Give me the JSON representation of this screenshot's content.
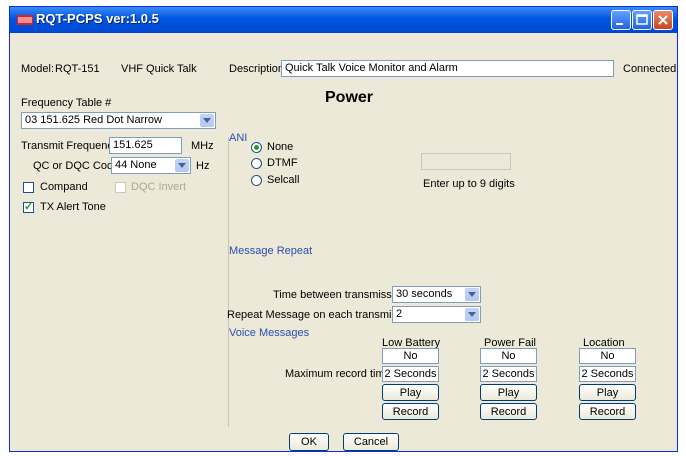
{
  "window": {
    "title": "RQT-PCPS ver:1.0.5"
  },
  "header": {
    "model_label": "Model:",
    "model_value": "RQT-151",
    "model_type": "VHF Quick Talk",
    "description_label": "Description:",
    "description_value": "Quick Talk Voice Monitor and Alarm",
    "status": "Connected"
  },
  "page_title": "Power",
  "left": {
    "freq_table_label": "Frequency Table #",
    "freq_table_value": "03  151.625  Red Dot  Narrow",
    "tx_freq_label": "Transmit Frequency",
    "tx_freq_value": "151.625",
    "tx_freq_unit": "MHz",
    "qc_label": "QC or DQC Code:",
    "qc_value": "44 None",
    "qc_unit": "Hz",
    "compand_label": "Compand",
    "compand_checked": false,
    "dqc_invert_label": "DQC Invert",
    "tx_alert_label": "TX Alert Tone",
    "tx_alert_checked": true
  },
  "ani": {
    "group_label": "ANI",
    "options": [
      "None",
      "DTMF",
      "Selcall"
    ],
    "selected": "None",
    "digits_value": "",
    "hint": "Enter up to 9 digits"
  },
  "message_repeat": {
    "group_label": "Message Repeat",
    "time_label": "Time between transmissions",
    "time_value": "30 seconds",
    "repeat_label": "Repeat Message on each transmission",
    "repeat_value": "2"
  },
  "voice_messages": {
    "group_label": "Voice Messages",
    "max_record_label": "Maximum record time",
    "play_label": "Play",
    "record_label": "Record",
    "columns": [
      {
        "name": "Low Battery",
        "status": "No",
        "time": "2 Seconds"
      },
      {
        "name": "Power Fail",
        "status": "No",
        "time": "2 Seconds"
      },
      {
        "name": "Location",
        "status": "No",
        "time": "2 Seconds"
      }
    ]
  },
  "footer": {
    "ok_label": "OK",
    "cancel_label": "Cancel"
  }
}
